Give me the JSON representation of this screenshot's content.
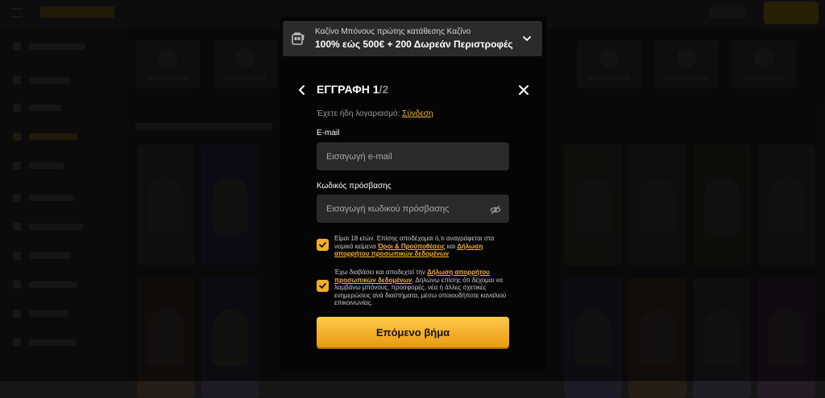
{
  "promo": {
    "subtitle": "Καζίνο Μπόνους πρώτης κατάθεσης Καζίνο",
    "title": "100% εώς 500€ + 200 Δωρεάν Περιστροφές"
  },
  "header": {
    "title": "ΕΓΓΡΑΦΗ",
    "step_current": "1",
    "step_total": "/2"
  },
  "account": {
    "prompt": "Έχετε ήδη λογαριασμό:",
    "login_link": "Σύνδεση"
  },
  "form": {
    "email_label": "E-mail",
    "email_placeholder": "Εισαγωγή e-mail",
    "email_value": "",
    "password_label": "Κωδικός πρόσβασης",
    "password_placeholder": "Εισαγωγή κωδικού πρόσβασης",
    "password_value": ""
  },
  "consents": [
    {
      "checked": true,
      "text_before": "Είμαι 18 ετών. Επίσης αποδέχομαι ό,τι αναγράφεται στα νομικά κείμενα ",
      "link1": "Όροι & Προϋποθέσεις",
      "text_middle": " και ",
      "link2": "Δήλωση απορρήτου προσωπικών δεδομένων"
    },
    {
      "checked": true,
      "text_before": "Έχω διαβάσει και αποδεχτεί την ",
      "link1": "Δήλωση απορρήτου προσωπικών δεδομένων",
      "text_after": ". Δηλώνω επίσης ότι δέχομαι να λαμβάνω μπόνους, προσφορές, νέα ή άλλες σχετικές ενημερώσεις ανά διαστήματα, μέσω οποιουδήποτε καναλιού επικοινωνίας."
    }
  ],
  "next_button_label": "Επόμενο βήμα",
  "colors": {
    "accent": "#f3b233",
    "button_top": "#ffc94a",
    "button_bottom": "#e89a12",
    "modal_bg": "#050505",
    "input_bg": "#2a2a2a"
  },
  "icons": {
    "promo": "slot-machine-icon",
    "promo_toggle": "chevron-down-icon",
    "back": "chevron-left-icon",
    "close": "close-icon",
    "password_visibility": "eye-slash-icon",
    "checkbox": "check-icon"
  }
}
